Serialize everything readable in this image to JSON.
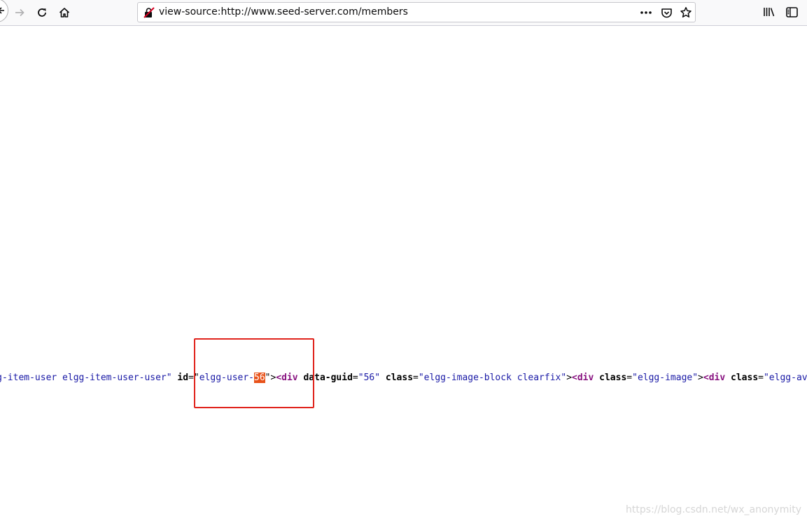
{
  "browser": {
    "url": "view-source:http://www.seed-server.com/members",
    "icons": {
      "back": "back-arrow-icon",
      "forward": "forward-arrow-icon",
      "reload": "reload-icon",
      "home": "home-icon",
      "insecure": "insecure-connection-icon",
      "page_actions": "more-icon",
      "pocket": "pocket-icon",
      "bookmark": "star-icon",
      "library": "library-icon",
      "sidebar": "sidebar-icon"
    }
  },
  "source": {
    "seg1": "m elgg-item-user elgg-item-user-user\"",
    "seg1_pre": "",
    "attr_id": "id",
    "eq1": "=\"",
    "id_prefix": "elgg-user-",
    "id_highlight": "56",
    "close1": "\">",
    "tag1": "<div",
    "attr_guid": "data-guid",
    "guid_value": "\"56\"",
    "attr_class1": "class",
    "class1_value": "\"elgg-image-block clearfix\"",
    "tag2": "<div",
    "attr_class2": "class",
    "class2_value": "\"elgg-image\"",
    "tag3": "<div",
    "attr_class3": "class",
    "class3_value": "\"elgg-avatar el"
  },
  "watermark": "https://blog.csdn.net/wx_anonymity",
  "colors": {
    "highlight": "#e8521a",
    "annotation": "#e0231c",
    "attr_value": "#1a1aa6",
    "tag": "#881280"
  }
}
